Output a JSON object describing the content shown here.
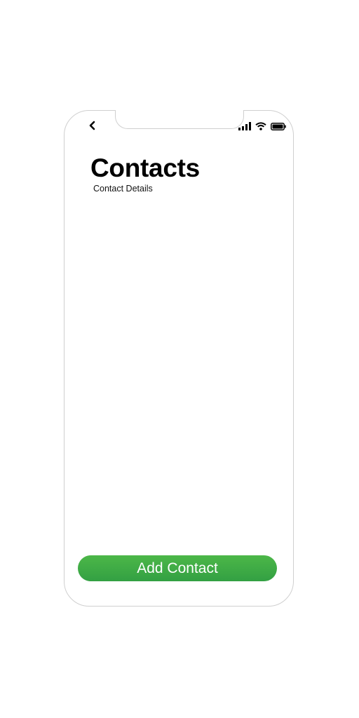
{
  "header": {
    "title": "Contacts",
    "subtitle": "Contact Details"
  },
  "actions": {
    "add_label": "Add Contact"
  },
  "icons": {
    "back": "chevron-left-icon",
    "signal": "cellular-signal-icon",
    "wifi": "wifi-icon",
    "battery": "battery-icon"
  },
  "colors": {
    "accent": "#3fab46",
    "text": "#000000",
    "background": "#ffffff"
  }
}
